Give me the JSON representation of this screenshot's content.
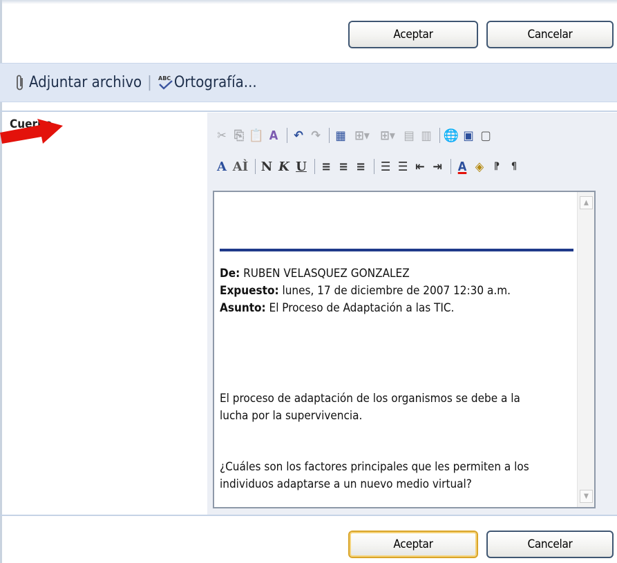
{
  "top_buttons": {
    "accept": "Aceptar",
    "cancel": "Cancelar"
  },
  "attach_bar": {
    "attach_label": "Adjuntar archivo",
    "spelling_label": "Ortografía..."
  },
  "field": {
    "label": "Cuerpo"
  },
  "message": {
    "from_label": "De:",
    "from_value": "RUBEN VELASQUEZ GONZALEZ",
    "posted_label": "Expuesto:",
    "posted_value": "lunes, 17 de diciembre de 2007 12:30 a.m.",
    "subject_label": "Asunto:",
    "subject_value": "El Proceso de Adaptación a las TIC.",
    "paragraph1_line1": "El proceso de adaptación de los organismos se debe a la",
    "paragraph1_line2": "lucha por la supervivencia.",
    "paragraph2_line1": "¿Cuáles son los factores principales que les permiten a los",
    "paragraph2_line2": "individuos adaptarse  a un nuevo medio virtual?"
  },
  "bottom_buttons": {
    "accept": "Aceptar",
    "cancel": "Cancelar"
  },
  "colors": {
    "accent_blue": "#1f3a8a",
    "arrow_red": "#e3120b",
    "bar_bg": "#dfe7f4"
  }
}
